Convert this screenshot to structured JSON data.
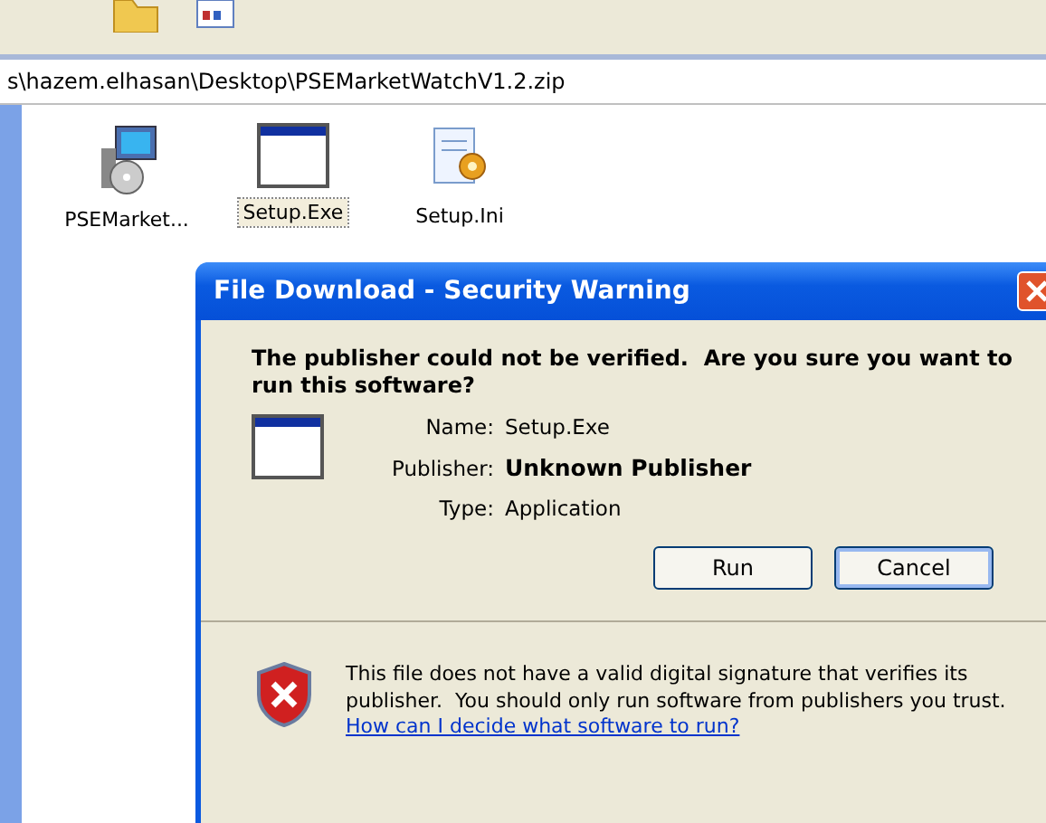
{
  "address_bar": {
    "path": "s\\hazem.elhasan\\Desktop\\PSEMarketWatchV1.2.zip"
  },
  "files": [
    {
      "name": "PSEMarket...",
      "kind": "installer",
      "selected": false
    },
    {
      "name": "Setup.Exe",
      "kind": "exe",
      "selected": true
    },
    {
      "name": "Setup.Ini",
      "kind": "ini",
      "selected": false
    }
  ],
  "dialog": {
    "title": "File Download - Security Warning",
    "question": "The publisher could not be verified.  Are you sure you want to run this software?",
    "fields": [
      {
        "label": "Name:",
        "value": "Setup.Exe",
        "bold": false
      },
      {
        "label": "Publisher:",
        "value": "Unknown Publisher",
        "bold": true
      },
      {
        "label": "Type:",
        "value": "Application",
        "bold": false
      }
    ],
    "buttons": [
      {
        "label": "Run",
        "focused": false
      },
      {
        "label": "Cancel",
        "focused": true
      }
    ],
    "warning": "This file does not have a valid digital signature that verifies its publisher.  You should only run software from publishers you trust.",
    "help_link": "How can I decide what software to run?"
  }
}
